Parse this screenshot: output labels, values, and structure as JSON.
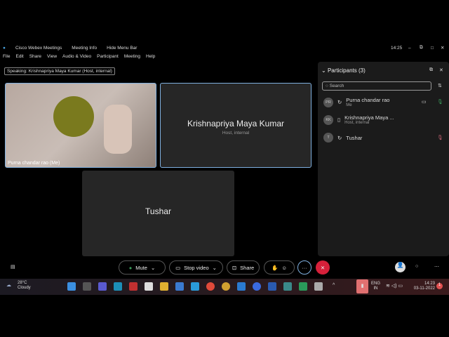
{
  "titlebar": {
    "app": "Cisco Webex Meetings",
    "meeting_info": "Meeting Info",
    "hide_menu": "Hide Menu Bar",
    "time": "14:25"
  },
  "menu": [
    "File",
    "Edit",
    "Share",
    "View",
    "Audio & Video",
    "Participant",
    "Meeting",
    "Help"
  ],
  "speaking": "Speaking: Krishnapriya Maya Kumar (Host, internal)",
  "tiles": [
    {
      "name": "Purna chandar rao (Me)"
    },
    {
      "name": "Krishnapriya Maya Kumar",
      "sub": "Host, internal"
    },
    {
      "name": "Tushar"
    }
  ],
  "participants": {
    "title": "Participants (3)",
    "search_placeholder": "Search",
    "list": [
      {
        "initials": "PR",
        "name": "Purna chandar rao",
        "sub": "Me"
      },
      {
        "initials": "KK",
        "name": "Krishnapriya Maya ...",
        "sub": "Host, internal"
      },
      {
        "initials": "T",
        "name": "Tushar",
        "sub": ""
      }
    ]
  },
  "toolbar": {
    "mute": "Mute",
    "stop_video": "Stop video",
    "share": "Share",
    "more": "···",
    "end": "✕"
  },
  "taskbar": {
    "temp": "28°C",
    "weather": "Cloudy",
    "lang1": "ENG",
    "lang2": "IN",
    "time": "14:23",
    "date": "03-11-2022",
    "badge": "1"
  },
  "colors": {
    "end": "#d6203a",
    "accent": "#7fb0e0"
  }
}
